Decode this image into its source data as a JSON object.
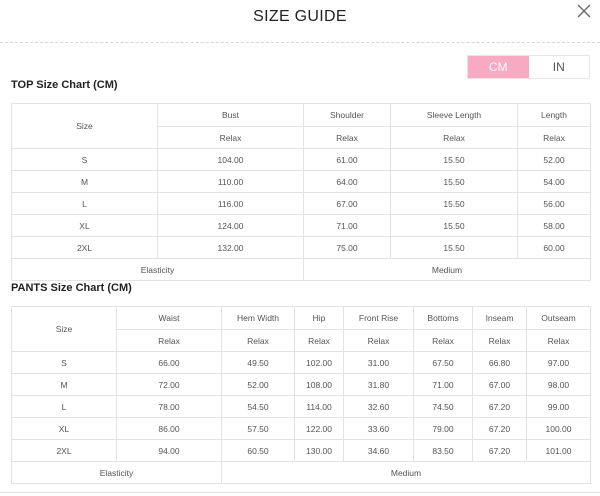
{
  "title": "SIZE GUIDE",
  "units": {
    "cm": "CM",
    "in": "IN",
    "active": "CM"
  },
  "top": {
    "title": "TOP Size Chart (CM)",
    "size_label": "Size",
    "columns": [
      "Bust",
      "Shoulder",
      "Sleeve Length",
      "Length"
    ],
    "fit": [
      "Relax",
      "Relax",
      "Relax",
      "Relax"
    ],
    "rows": [
      {
        "size": "S",
        "values": [
          "104.00",
          "61.00",
          "15.50",
          "52.00"
        ]
      },
      {
        "size": "M",
        "values": [
          "110.00",
          "64.00",
          "15.50",
          "54.00"
        ]
      },
      {
        "size": "L",
        "values": [
          "116.00",
          "67.00",
          "15.50",
          "56.00"
        ]
      },
      {
        "size": "XL",
        "values": [
          "124.00",
          "71.00",
          "15.50",
          "58.00"
        ]
      },
      {
        "size": "2XL",
        "values": [
          "132.00",
          "75.00",
          "15.50",
          "60.00"
        ]
      }
    ],
    "elasticity_label": "Elasticity",
    "elasticity_value": "Medium"
  },
  "pants": {
    "title": "PANTS Size Chart (CM)",
    "size_label": "Size",
    "columns": [
      "Waist",
      "Hem Width",
      "Hip",
      "Front Rise",
      "Bottoms",
      "Inseam",
      "Outseam"
    ],
    "fit": [
      "Relax",
      "Relax",
      "Relax",
      "Relax",
      "Relax",
      "Relax",
      "Relax"
    ],
    "rows": [
      {
        "size": "S",
        "values": [
          "66.00",
          "49.50",
          "102.00",
          "31.00",
          "67.50",
          "66.80",
          "97.00"
        ]
      },
      {
        "size": "M",
        "values": [
          "72.00",
          "52.00",
          "108.00",
          "31.80",
          "71.00",
          "67.00",
          "98.00"
        ]
      },
      {
        "size": "L",
        "values": [
          "78.00",
          "54.50",
          "114.00",
          "32.60",
          "74.50",
          "67.20",
          "99.00"
        ]
      },
      {
        "size": "XL",
        "values": [
          "86.00",
          "57.50",
          "122.00",
          "33.60",
          "79.00",
          "67.20",
          "100.00"
        ]
      },
      {
        "size": "2XL",
        "values": [
          "94.00",
          "60.50",
          "130.00",
          "34.60",
          "83.50",
          "67.20",
          "101.00"
        ]
      }
    ],
    "elasticity_label": "Elasticity",
    "elasticity_value": "Medium"
  }
}
